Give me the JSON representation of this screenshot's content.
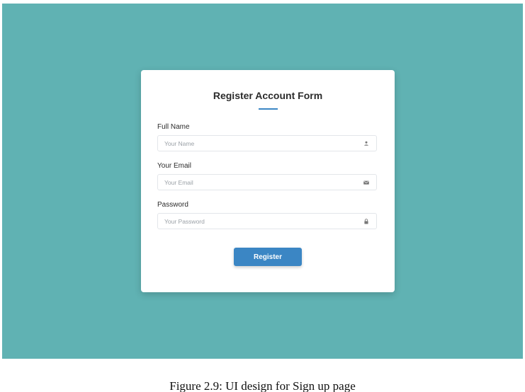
{
  "form": {
    "title": "Register Account Form",
    "fields": [
      {
        "label": "Full Name",
        "placeholder": "Your Name",
        "icon": "user-icon"
      },
      {
        "label": "Your Email",
        "placeholder": "Your Email",
        "icon": "mail-icon"
      },
      {
        "label": "Password",
        "placeholder": "Your Password",
        "icon": "lock-icon"
      }
    ],
    "submit_label": "Register"
  },
  "caption": "Figure 2.9: UI design for Sign up page",
  "colors": {
    "background": "#60b2b3",
    "accent": "#3b86c4",
    "card": "#ffffff"
  }
}
